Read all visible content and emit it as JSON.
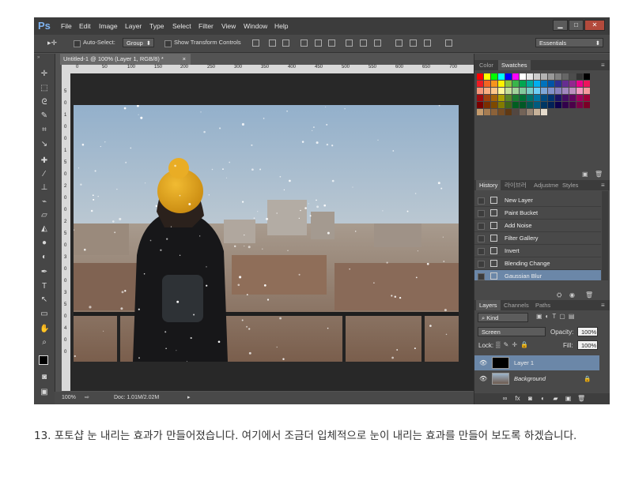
{
  "app": {
    "logo": "Ps",
    "menu": [
      "File",
      "Edit",
      "Image",
      "Layer",
      "Type",
      "Select",
      "Filter",
      "View",
      "Window",
      "Help"
    ],
    "window_buttons": [
      "▁",
      "□",
      "✕"
    ]
  },
  "options_bar": {
    "auto_select_label": "Auto-Select:",
    "auto_select_value": "Group",
    "transform_label": "Show Transform Controls",
    "workspace": "Essentials"
  },
  "document": {
    "tab_title": "Untitled-1 @ 100% (Layer 1, RGB/8) *",
    "tab_close": "×",
    "ruler_ticks": [
      "0",
      "50",
      "100",
      "150",
      "200",
      "250",
      "300",
      "350",
      "400",
      "450",
      "500",
      "550",
      "600",
      "650",
      "700"
    ],
    "vruler_ticks": [
      "5",
      "0",
      "1",
      "0",
      "0",
      "1",
      "5",
      "0",
      "2",
      "0",
      "0",
      "2",
      "5",
      "0",
      "3",
      "0",
      "0",
      "3",
      "5",
      "0",
      "4",
      "0",
      "0"
    ],
    "zoom": "100%",
    "doc_info": "Doc: 1.01M/2.02M"
  },
  "color_panel": {
    "tabs": [
      "Color",
      "Swatches"
    ],
    "active_tab": "Swatches"
  },
  "history_panel": {
    "tabs": [
      "History",
      "라이브러",
      "Adjustme",
      "Styles"
    ],
    "active_tab": "History",
    "items": [
      "New Layer",
      "Paint Bucket",
      "Add Noise",
      "Filter Gallery",
      "Invert",
      "Blending Change",
      "Gaussian Blur"
    ],
    "selected": "Gaussian Blur"
  },
  "layers_panel": {
    "tabs": [
      "Layers",
      "Channels",
      "Paths"
    ],
    "active_tab": "Layers",
    "filter": "Kind",
    "blend_mode": "Screen",
    "opacity_label": "Opacity:",
    "opacity": "100%",
    "lock_label": "Lock:",
    "fill_label": "Fill:",
    "fill": "100%",
    "layers": [
      "Layer 1",
      "Background"
    ],
    "selected_layer": "Layer 1"
  },
  "caption": "13. 포토샵 눈 내리는 효과가 만들어졌습니다. 여기에서 조금더 입체적으로 눈이 내리는 효과를 만들어 보도록 하겠습니다.",
  "colors": {
    "selection": "#6b87a8",
    "canvas_sky": "#a9c2d9",
    "beanie": "#e0a21c"
  }
}
